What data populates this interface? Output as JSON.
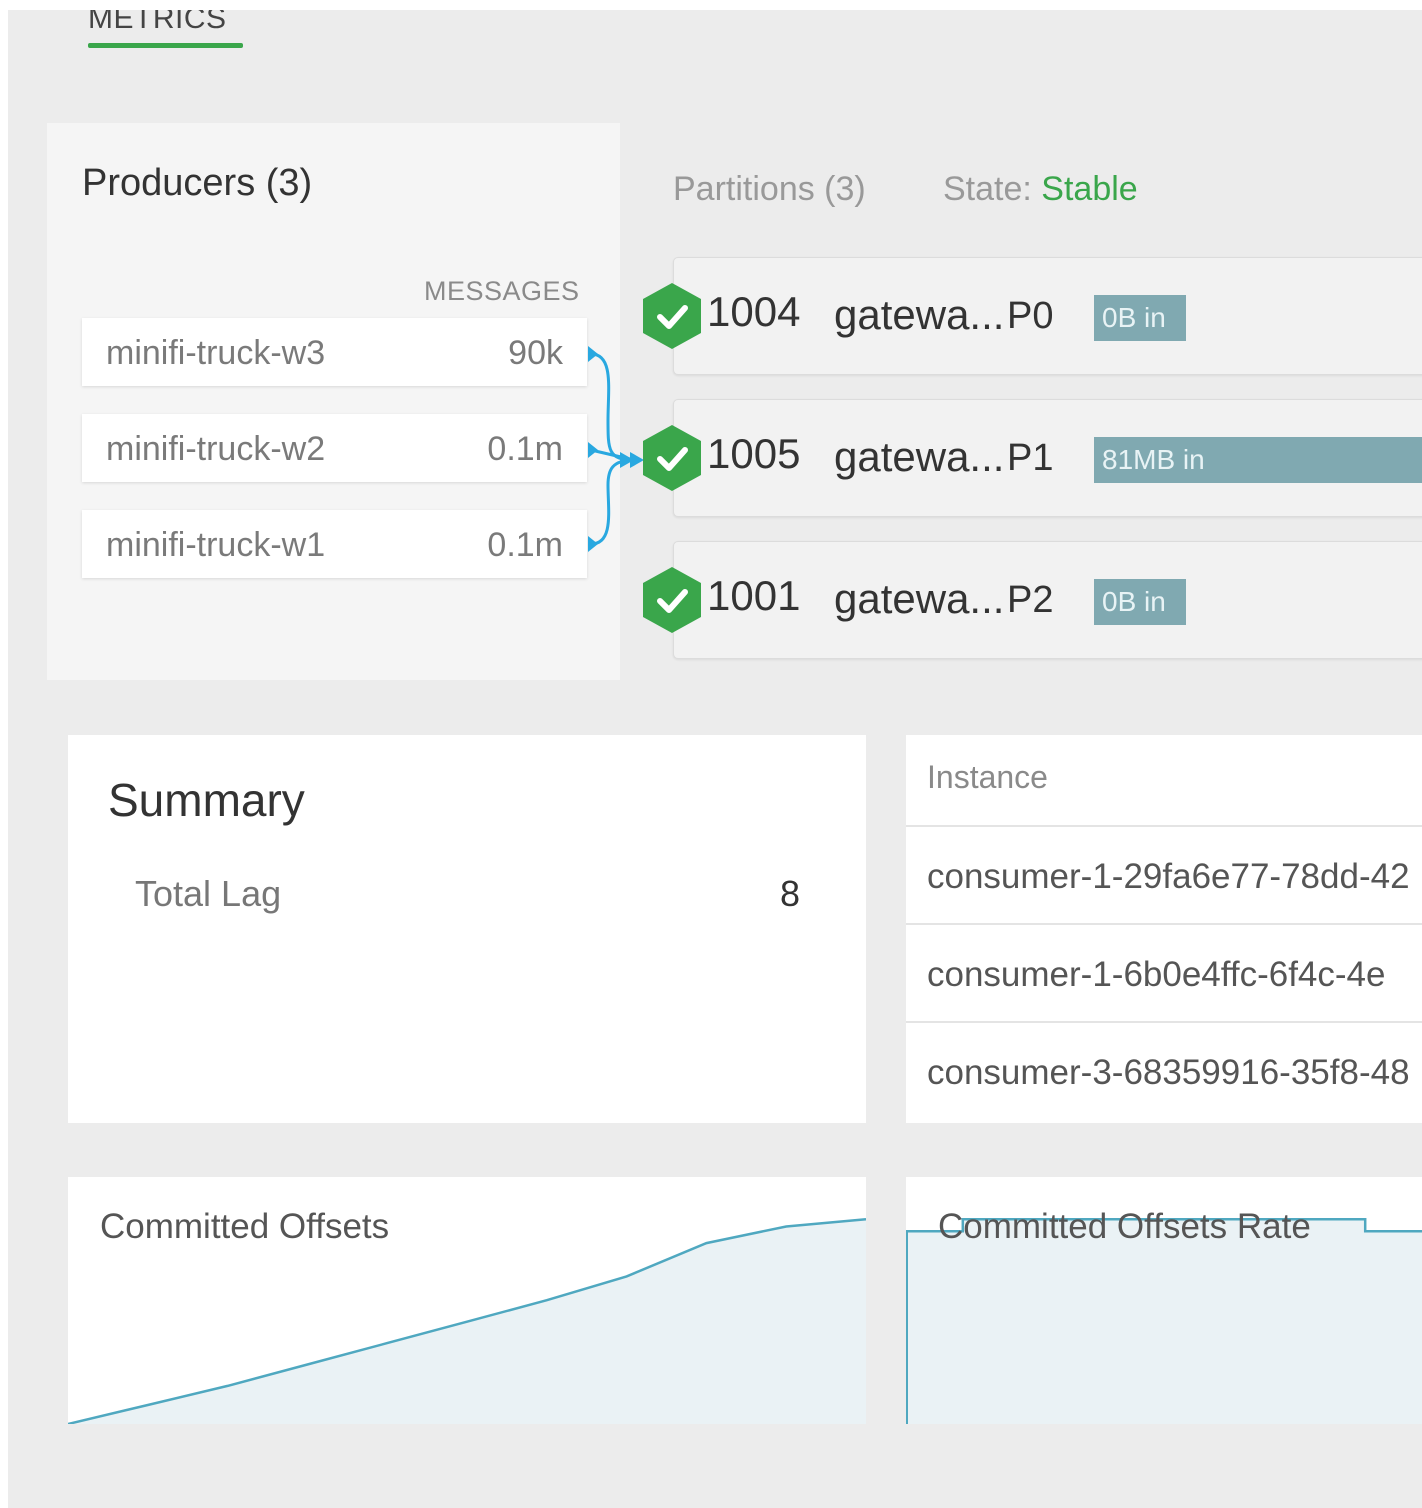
{
  "tab": {
    "label": "METRICS"
  },
  "producers": {
    "title": "Producers (3)",
    "column_header": "MESSAGES",
    "rows": [
      {
        "name": "minifi-truck-w3",
        "messages": "90k"
      },
      {
        "name": "minifi-truck-w2",
        "messages": "0.1m"
      },
      {
        "name": "minifi-truck-w1",
        "messages": "0.1m"
      }
    ]
  },
  "partitions": {
    "title": "Partitions (3)",
    "state_label": "State:",
    "state_value": "Stable",
    "rows": [
      {
        "broker_id": "1004",
        "host": "gatewa...",
        "partition": "P0",
        "bytes_in": "0B in",
        "bytes_fill": 0.27
      },
      {
        "broker_id": "1005",
        "host": "gatewa...",
        "partition": "P1",
        "bytes_in": "81MB in",
        "bytes_fill": 1.0
      },
      {
        "broker_id": "1001",
        "host": "gatewa...",
        "partition": "P2",
        "bytes_in": "0B in",
        "bytes_fill": 0.27
      }
    ]
  },
  "summary": {
    "title": "Summary",
    "total_lag_label": "Total Lag",
    "total_lag_value": "8"
  },
  "instances": {
    "header": "Instance",
    "rows": [
      "consumer-1-29fa6e77-78dd-42",
      "consumer-1-6b0e4ffc-6f4c-4e",
      "consumer-3-68359916-35f8-48"
    ]
  },
  "charts": {
    "committed_offsets": {
      "title": "Committed Offsets",
      "points": [
        [
          0,
          0
        ],
        [
          0.1,
          0.08
        ],
        [
          0.2,
          0.16
        ],
        [
          0.3,
          0.25
        ],
        [
          0.4,
          0.34
        ],
        [
          0.5,
          0.43
        ],
        [
          0.6,
          0.52
        ],
        [
          0.7,
          0.62
        ],
        [
          0.8,
          0.76
        ],
        [
          0.9,
          0.83
        ],
        [
          1.0,
          0.86
        ]
      ]
    },
    "committed_offsets_rate": {
      "title": "Committed Offsets Rate",
      "points": [
        [
          0,
          0.81
        ],
        [
          0.11,
          0.81
        ],
        [
          0.11,
          0.86
        ],
        [
          0.89,
          0.86
        ],
        [
          0.89,
          0.81
        ],
        [
          1.0,
          0.81
        ]
      ]
    }
  },
  "colors": {
    "accent_green": "#3aa64b",
    "link_blue": "#29a8e0",
    "bar_teal": "#80a9b1",
    "chart_line": "#4fa8c0",
    "chart_fill": "#eaf2f5"
  }
}
